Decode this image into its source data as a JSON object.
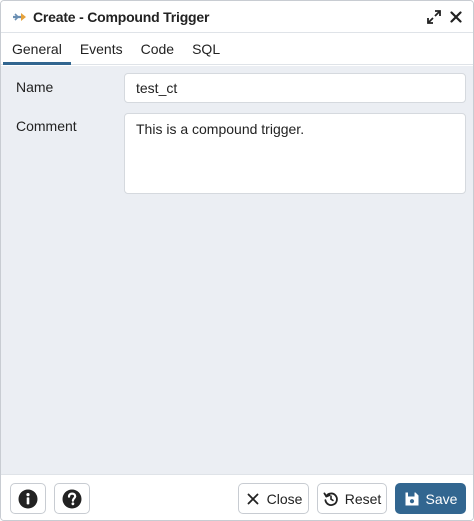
{
  "dialog": {
    "title": "Create - Compound Trigger",
    "icons": {
      "app": "compound-trigger-icon",
      "expand": "expand-icon",
      "close": "close-icon"
    }
  },
  "tabs": [
    {
      "label": "General",
      "active": true
    },
    {
      "label": "Events",
      "active": false
    },
    {
      "label": "Code",
      "active": false
    },
    {
      "label": "SQL",
      "active": false
    }
  ],
  "form": {
    "name_label": "Name",
    "name_value": "test_ct",
    "comment_label": "Comment",
    "comment_value": "This is a compound trigger."
  },
  "footer": {
    "info_icon": "info-icon",
    "help_icon": "help-icon",
    "close_label": "Close",
    "reset_label": "Reset",
    "save_label": "Save"
  },
  "colors": {
    "accent": "#326690",
    "panel_background": "#ebeef3",
    "border": "#c8ccd2"
  }
}
